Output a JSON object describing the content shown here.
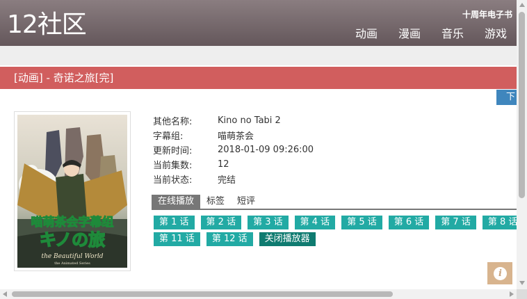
{
  "site": {
    "logo": "12社区",
    "header_link": "十周年电子书",
    "nav": [
      "动画",
      "漫画",
      "音乐",
      "游戏"
    ]
  },
  "page": {
    "title": "[动画] - 奇诺之旅[完]",
    "download_label": "下"
  },
  "poster": {
    "overlay_line1": "喵萌茶会字幕组",
    "overlay_line2": "キノの旅",
    "overlay_line3": "the Beautiful World",
    "overlay_line4": "the Animated Series"
  },
  "details": [
    {
      "label": "其他名称:",
      "value": "Kino no Tabi 2"
    },
    {
      "label": "字幕组:",
      "value": "喵萌茶会"
    },
    {
      "label": "更新时间:",
      "value": "2018-01-09 09:26:00"
    },
    {
      "label": "当前集数:",
      "value": "12"
    },
    {
      "label": "当前状态:",
      "value": "完结"
    }
  ],
  "tabs": [
    {
      "label": "在线播放",
      "active": true
    },
    {
      "label": "标签",
      "active": false
    },
    {
      "label": "短评",
      "active": false
    }
  ],
  "episodes_row1": [
    "第 1 话",
    "第 2 话",
    "第 3 话",
    "第 4 话",
    "第 5 话",
    "第 6 话",
    "第 7 话",
    "第 8 话"
  ],
  "episodes_row2": [
    "第 11 话",
    "第 12 话"
  ],
  "close_player_label": "关闭播放器",
  "colors": {
    "header": "#6f6266",
    "title_bar": "#d15e5e",
    "episode_button": "#22aaa4",
    "close_button": "#0f7b70",
    "download_button": "#3f86bd"
  }
}
